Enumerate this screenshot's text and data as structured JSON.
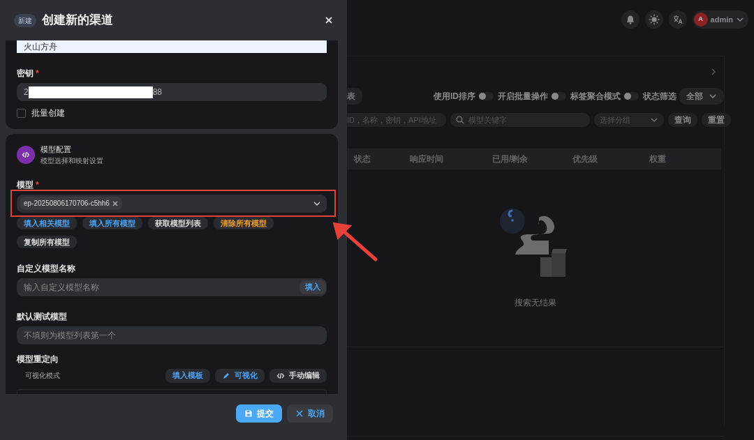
{
  "header": {
    "user_initial": "A",
    "username": "admin"
  },
  "panel": {
    "partial_tab": "表",
    "toggles": [
      {
        "label": "使用ID排序",
        "on": false
      },
      {
        "label": "开启批量操作",
        "on": false
      },
      {
        "label": "标签聚合模式",
        "on": false
      }
    ],
    "status_filter": {
      "label": "状态筛选",
      "value": "全部"
    },
    "search_fields": [
      {
        "placeholder": "ID，名称，密钥，API地址"
      },
      {
        "placeholder": "模型关键字"
      }
    ],
    "group_select": {
      "placeholder": "选择分组"
    },
    "buttons": [
      "查询",
      "重置"
    ],
    "table": {
      "columns": [
        "状态",
        "响应时间",
        "已用/剩余",
        "优先级",
        "权重"
      ]
    },
    "empty_text": "搜索无结果"
  },
  "drawer": {
    "badge": "新建",
    "title": "创建新的渠道",
    "name_value": "火山方舟",
    "key": {
      "label": "密钥",
      "required_mark": "*",
      "value_start": "2",
      "value_end": "88"
    },
    "batch": {
      "label": "批量创建",
      "checked": false
    },
    "model_section": {
      "title": "模型配置",
      "subtitle": "模型选择和映射设置"
    },
    "models": {
      "label": "模型",
      "required_mark": "*",
      "tags": [
        "ep-20250806170706-c5hh6"
      ]
    },
    "model_actions": [
      {
        "label": "填入相关模型",
        "kind": "primary"
      },
      {
        "label": "填入所有模型",
        "kind": "primary"
      },
      {
        "label": "获取模型列表",
        "kind": "default"
      },
      {
        "label": "清除所有模型",
        "kind": "warning"
      },
      {
        "label": "复制所有模型",
        "kind": "default"
      }
    ],
    "custom_model": {
      "label": "自定义模型名称",
      "placeholder": "输入自定义模型名称",
      "button": "填入"
    },
    "test_model": {
      "label": "默认测试模型",
      "placeholder": "不填则为模型列表第一个"
    },
    "redirect": {
      "label": "模型重定向",
      "mode": "可视化模式",
      "buttons": [
        {
          "label": "填入模板",
          "kind": "primary"
        },
        {
          "label": "可视化",
          "kind": "primary"
        },
        {
          "label": "手动编辑",
          "kind": "default"
        }
      ]
    },
    "footer": [
      {
        "label": "提交",
        "kind": "primary"
      },
      {
        "label": "取消",
        "kind": "secondary"
      }
    ]
  }
}
